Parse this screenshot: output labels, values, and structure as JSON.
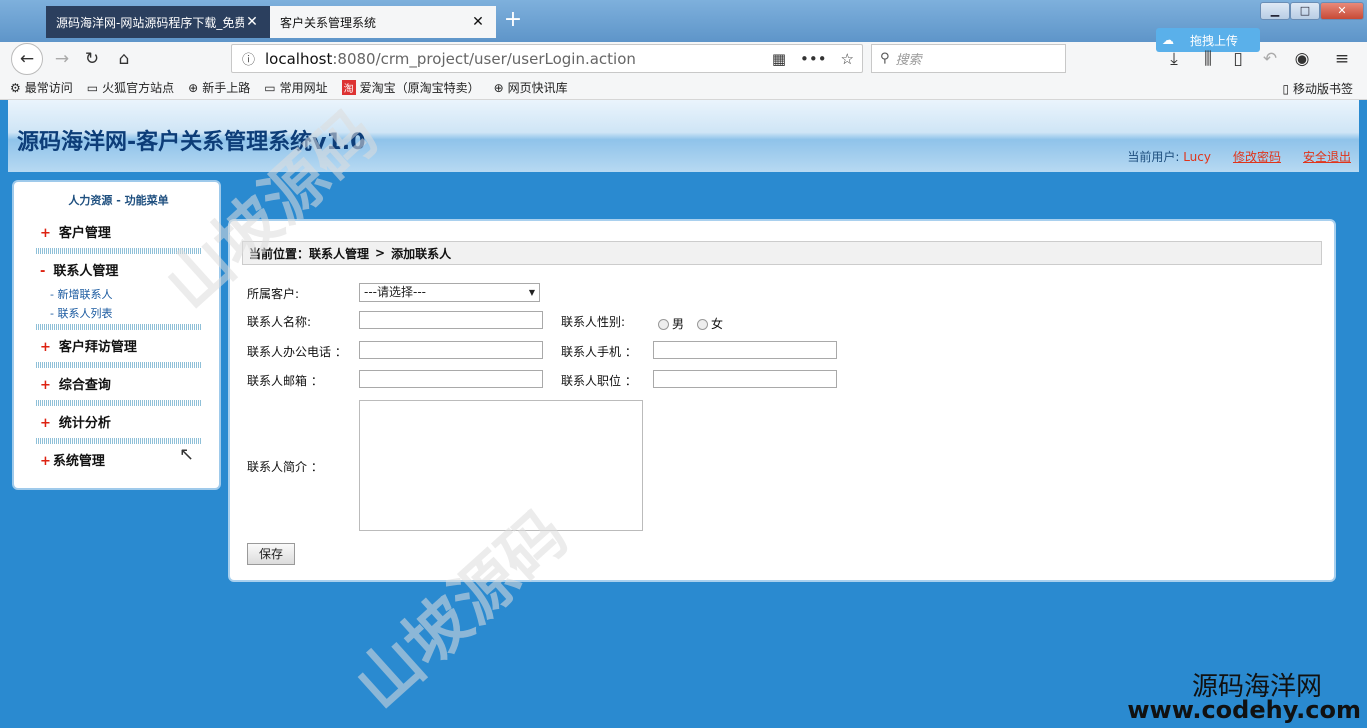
{
  "browser": {
    "tabs": [
      {
        "label": "源码海洋网-网站源码程序下载_免费"
      },
      {
        "label": "客户关系管理系统"
      }
    ],
    "url_host": "localhost",
    "url_path": ":8080/crm_project/user/userLogin.action",
    "search_placeholder": "搜索",
    "cloud_button": "拖拽上传",
    "bookmarks": [
      "最常访问",
      "火狐官方站点",
      "新手上路",
      "常用网址",
      "爱淘宝（原淘宝特卖）",
      "网页快讯库"
    ],
    "mobile_bookmarks": "移动版书签"
  },
  "app": {
    "title": "源码海洋网-客户关系管理系统v1.0",
    "current_user_label": "当前用户:",
    "current_user": "Lucy",
    "change_password": "修改密码",
    "logout": "安全退出"
  },
  "sidebar": {
    "title": "人力资源  - 功能菜单",
    "items": [
      {
        "prefix": "+",
        "label": "客户管理"
      },
      {
        "prefix": "-",
        "label": "联系人管理"
      },
      {
        "prefix": "+",
        "label": "客户拜访管理"
      },
      {
        "prefix": "+",
        "label": "综合查询"
      },
      {
        "prefix": "+",
        "label": "统计分析"
      },
      {
        "prefix": "+",
        "label": "系统管理"
      }
    ],
    "subitems": [
      "-  新增联系人",
      "- 联系人列表"
    ]
  },
  "main": {
    "breadcrumb_prefix": "当前位置：联系人管理",
    "breadcrumb_sep": ">",
    "breadcrumb_page": "添加联系人",
    "form": {
      "customer_label": "所属客户:",
      "customer_select": "---请选择---",
      "name_label": "联系人名称:",
      "gender_label": "联系人性别:",
      "gender_male": "男",
      "gender_female": "女",
      "phone_label": "联系人办公电话 ：",
      "mobile_label": "联系人手机 ：",
      "email_label": "联系人邮箱 ：",
      "position_label": "联系人职位 ：",
      "intro_label": "联系人简介 ：",
      "save": "保存"
    }
  },
  "watermark": {
    "text": "山坡源码",
    "brand_line1": "源码海洋网",
    "brand_line2": "www.codehy.com"
  }
}
